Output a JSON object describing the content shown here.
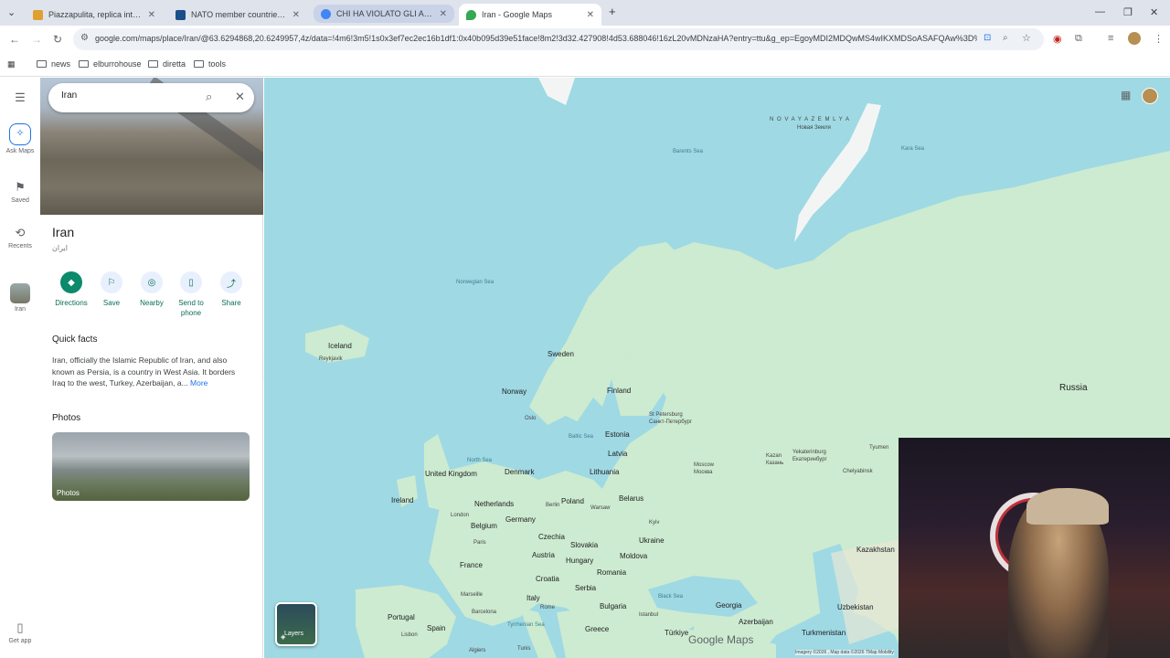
{
  "browser": {
    "tabs": [
      {
        "label": "Piazzapulita, replica integrale d",
        "favicon_color": "#e0a030"
      },
      {
        "label": "NATO member countries | NATO",
        "favicon_color": "#1a4f8a"
      },
      {
        "label": "CHI HA VIOLATO GLI ACCORDI",
        "favicon_color": "#4285f4"
      },
      {
        "label": "Iran - Google Maps",
        "favicon_color": "#34a853"
      }
    ],
    "url": "google.com/maps/place/Iran/@63.6294868,20.6249957,4z/data=!4m6!3m5!1s0x3ef7ec2ec16b1df1:0x40b095d39e51face!8m2!3d32.427908!4d53.688046!16zL20vMDNzaHA?entry=ttu&g_ep=EgoyMDI2MDQwMS4wIKXMDSoASAFQAw%3D%3D",
    "bookmarks": [
      "news",
      "elburrohouse",
      "diretta",
      "tools"
    ]
  },
  "rail": {
    "ask_maps": "Ask Maps",
    "saved": "Saved",
    "recents": "Recents",
    "recent_place": "Iran",
    "get_app": "Get app"
  },
  "panel": {
    "search_value": "Iran",
    "title": "Iran",
    "subtitle": "ایران",
    "actions": {
      "directions": "Directions",
      "save": "Save",
      "nearby": "Nearby",
      "send_to_phone": "Send to phone",
      "share": "Share"
    },
    "quick_facts_title": "Quick facts",
    "quick_facts_text": "Iran, officially the Islamic Republic of Iran, and also known as Persia, is a country in West Asia. It borders Iraq to the west, Turkey, Azerbaijan, a... ",
    "more_link": "More",
    "photos_title": "Photos",
    "photos_label": "Photos"
  },
  "map": {
    "labels": {
      "novaya": "N O V A Y A  Z E M L Y A",
      "novaya_ru": "Новая Земля",
      "barents": "Barents Sea",
      "kara": "Kara Sea",
      "norwegian": "Norwegian Sea",
      "iceland": "Iceland",
      "reykjavik": "Reykjavik",
      "sweden": "Sweden",
      "norway": "Norway",
      "finland": "Finland",
      "oslo": "Oslo",
      "st_petersburg": "St Petersburg",
      "st_petersburg_ru": "Санкт-Петербург",
      "estonia": "Estonia",
      "latvia": "Latvia",
      "lithuania": "Lithuania",
      "baltic": "Baltic Sea",
      "north_sea": "North Sea",
      "denmark": "Denmark",
      "uk": "United Kingdom",
      "ireland": "Ireland",
      "netherlands": "Netherlands",
      "berlin": "Berlin",
      "poland": "Poland",
      "belarus": "Belarus",
      "warsaw": "Warsaw",
      "moscow": "Moscow",
      "moscow_ru": "Москва",
      "kazan": "Kazan",
      "kazan_ru": "Казань",
      "yekaterinburg": "Yekaterinburg",
      "yekaterinburg_ru": "Екатеринбург",
      "tyumen": "Tyumen",
      "chelyabinsk": "Chelyabinsk",
      "russia": "Russia",
      "belgium": "Belgium",
      "germany": "Germany",
      "london": "London",
      "paris": "Paris",
      "czechia": "Czechia",
      "slovakia": "Slovakia",
      "austria": "Austria",
      "hungary": "Hungary",
      "kyiv": "Kyiv",
      "ukraine": "Ukraine",
      "moldova": "Moldova",
      "france": "France",
      "croatia": "Croatia",
      "romania": "Romania",
      "serbia": "Serbia",
      "marseille": "Marseille",
      "italy": "Italy",
      "rome": "Rome",
      "bulgaria": "Bulgaria",
      "black_sea": "Black Sea",
      "barcelona": "Barcelona",
      "portugal": "Portugal",
      "spain": "Spain",
      "lisbon": "Lisbon",
      "tyrrhenian": "Tyrrhenian Sea",
      "greece": "Greece",
      "istanbul": "Istanbul",
      "turkiye": "Türkiye",
      "georgia": "Georgia",
      "azerbaijan": "Azerbaijan",
      "kazakhstan": "Kazakhstan",
      "uzbekistan": "Uzbekistan",
      "turkmenistan": "Turkmenistan",
      "algiers": "Algiers",
      "tunis": "Tunis"
    },
    "layers_label": "Layers",
    "google_maps": "Google Maps",
    "attribution": "Imagery ©2026 , Map data ©2026 TMap Mobility"
  },
  "colors": {
    "water": "#9fd9e4",
    "land": "#cdebd0",
    "accent": "#0b8a6c",
    "link": "#1a73e8"
  }
}
